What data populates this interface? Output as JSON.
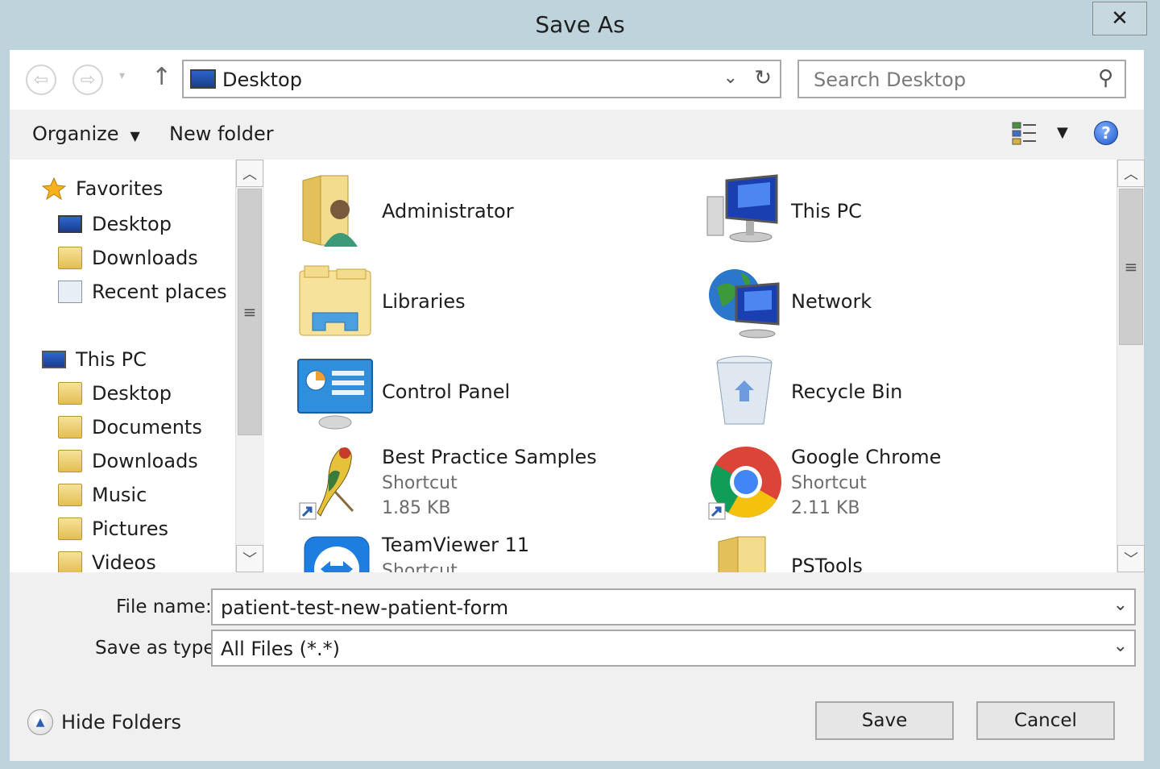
{
  "window": {
    "title": "Save As",
    "close_label": "✕"
  },
  "nav": {
    "back_glyph": "⇦",
    "forward_glyph": "⇨",
    "recent_glyph": "▾",
    "up_glyph": "↑",
    "address": "Desktop",
    "address_chevron": "⌄",
    "refresh_glyph": "↻",
    "search_placeholder": "Search Desktop",
    "search_glyph": "⚲"
  },
  "command_bar": {
    "organize": "Organize",
    "organize_caret": "▼",
    "new_folder": "New folder",
    "view_drop": "▼",
    "help": "?"
  },
  "nav_pane": {
    "favorites_label": "Favorites",
    "favorites": [
      "Desktop",
      "Downloads",
      "Recent places"
    ],
    "this_pc_label": "This PC",
    "this_pc": [
      "Desktop",
      "Documents",
      "Downloads",
      "Music",
      "Pictures",
      "Videos"
    ],
    "scroll_up": "︿",
    "scroll_down": "﹀",
    "thumb_grip": "≡"
  },
  "files": [
    {
      "name": "Administrator",
      "sub1": "",
      "sub2": ""
    },
    {
      "name": "This PC",
      "sub1": "",
      "sub2": ""
    },
    {
      "name": "Libraries",
      "sub1": "",
      "sub2": ""
    },
    {
      "name": "Network",
      "sub1": "",
      "sub2": ""
    },
    {
      "name": "Control Panel",
      "sub1": "",
      "sub2": ""
    },
    {
      "name": "Recycle Bin",
      "sub1": "",
      "sub2": ""
    },
    {
      "name": "Best Practice Samples",
      "sub1": "Shortcut",
      "sub2": "1.85 KB"
    },
    {
      "name": "Google Chrome",
      "sub1": "Shortcut",
      "sub2": "2.11 KB"
    },
    {
      "name": "TeamViewer 11",
      "sub1": "Shortcut",
      "sub2": ""
    },
    {
      "name": "PSTools",
      "sub1": "",
      "sub2": ""
    }
  ],
  "form": {
    "file_name_label": "File name:",
    "file_name_value": "patient-test-new-patient-form",
    "type_label": "Save as type:",
    "type_value": "All Files (*.*)",
    "chevron": "⌄"
  },
  "footer": {
    "hide_folders": "Hide Folders",
    "hide_glyph": "▲",
    "save": "Save",
    "cancel": "Cancel"
  }
}
